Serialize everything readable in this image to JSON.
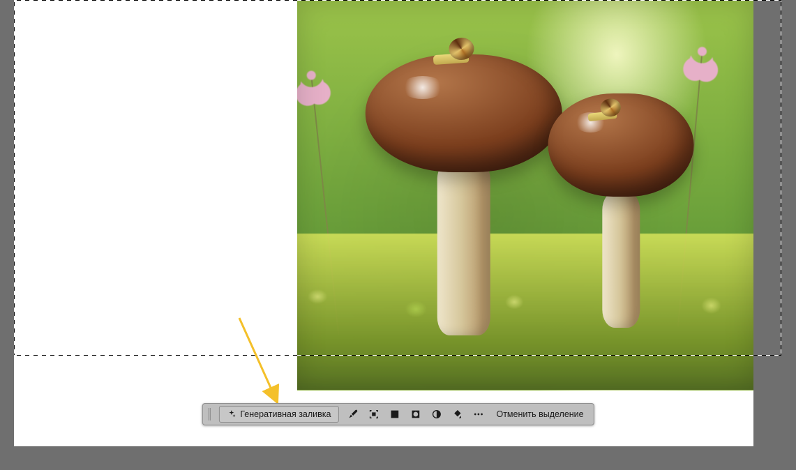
{
  "taskbar": {
    "generative_fill_label": "Генеративная заливка",
    "deselect_label": "Отменить выделение",
    "icons": {
      "sparkle": "sparkle-icon",
      "brush": "brush-icon",
      "select_subject": "select-subject-icon",
      "mask": "mask-icon",
      "adjust": "adjust-icon",
      "fill": "fill-icon",
      "more": "more-icon"
    }
  },
  "annotation": {
    "arrow_color": "#f4c02a"
  }
}
